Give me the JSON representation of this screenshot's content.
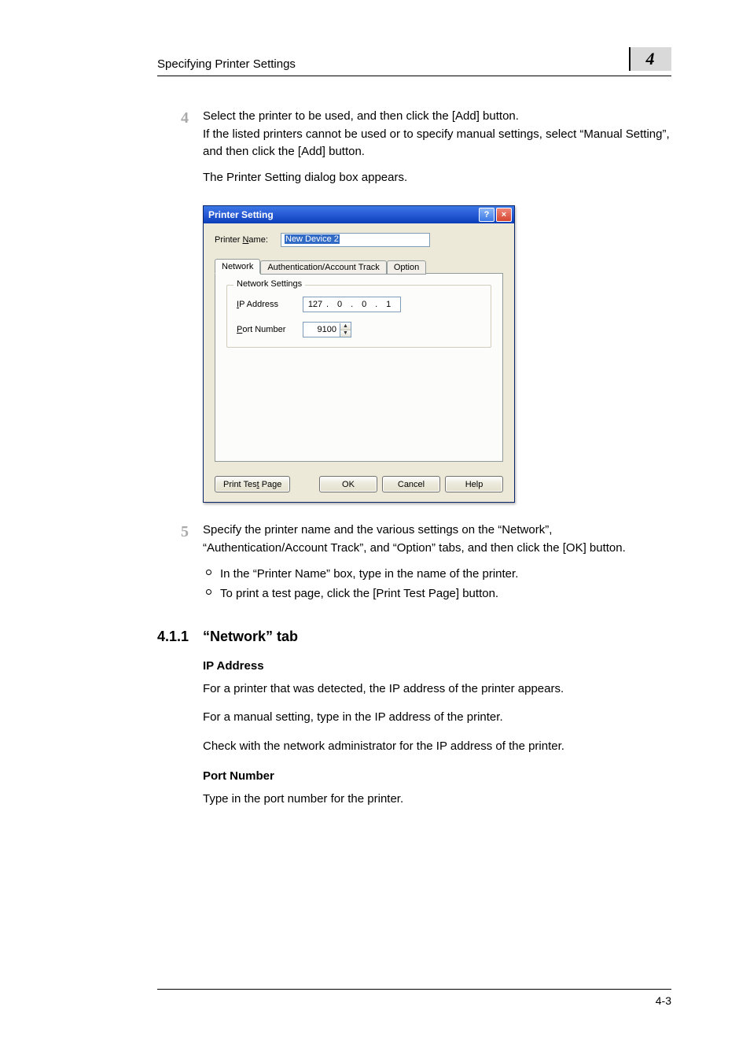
{
  "header": {
    "title": "Specifying Printer Settings",
    "chapter_number": "4"
  },
  "steps": {
    "s4": {
      "num": "4",
      "line1": "Select the printer to be used, and then click the [Add] button.",
      "line2": "If the listed printers cannot be used or to specify manual settings, select “Manual Setting”, and then click the [Add] button.",
      "line3": "The Printer Setting dialog box appears."
    },
    "s5": {
      "num": "5",
      "body": "Specify the printer name and the various settings on the “Network”, “Authentication/Account Track”, and “Option” tabs, and then click the [OK] button.",
      "b1": "In the “Printer Name” box, type in the name of the printer.",
      "b2": "To print a test page, click the [Print Test Page] button."
    }
  },
  "dialog": {
    "title": "Printer Setting",
    "help_glyph": "?",
    "close_glyph": "×",
    "printer_name_label_pre": "Printer ",
    "printer_name_label_u": "N",
    "printer_name_label_post": "ame:",
    "printer_name_value": "New Device 2",
    "tabs": {
      "network": "Network",
      "auth": "Authentication/Account Track",
      "option": "Option"
    },
    "group_legend": "Network Settings",
    "ip_label_u": "I",
    "ip_label_post": "P Address",
    "ip": {
      "a": "127",
      "b": "0",
      "c": "0",
      "d": "1"
    },
    "port_label_u": "P",
    "port_label_post": "ort Number",
    "port_value": "9100",
    "btn_print_test_pre": "Print Tes",
    "btn_print_test_u": "t",
    "btn_print_test_post": " Page",
    "btn_ok": "OK",
    "btn_cancel": "Cancel",
    "btn_help": "Help"
  },
  "section": {
    "number": "4.1.1",
    "title": "“Network” tab",
    "ip_heading": "IP Address",
    "ip_p1": "For a printer that was detected, the IP address of the printer appears.",
    "ip_p2": "For a manual setting, type in the IP address of the printer.",
    "ip_p3": "Check with the network administrator for the IP address of the printer.",
    "port_heading": "Port Number",
    "port_p1": "Type in the port number for the printer."
  },
  "footer": {
    "page": "4-3"
  }
}
